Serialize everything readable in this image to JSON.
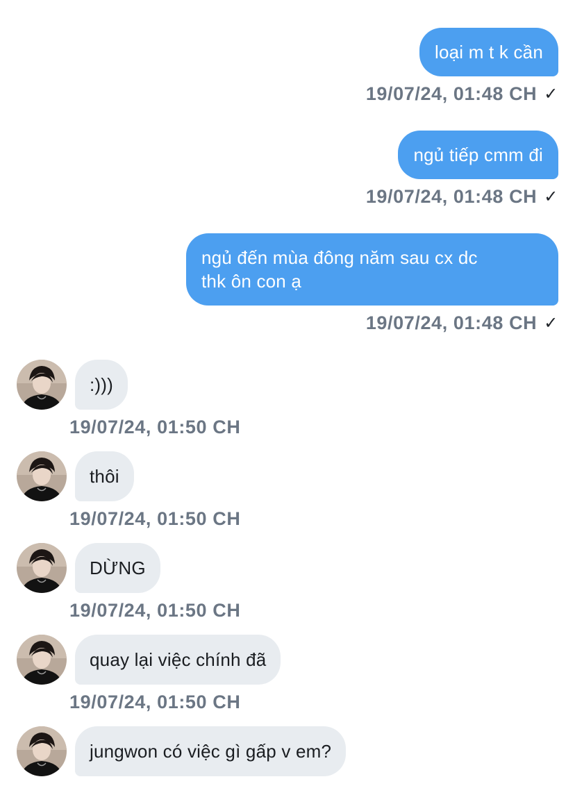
{
  "colors": {
    "outgoing_bubble": "#4c9ff0",
    "incoming_bubble": "#e8ecf0",
    "timestamp": "#6b7684"
  },
  "messages": [
    {
      "direction": "outgoing",
      "text": "loại m t k cần",
      "timestamp": "19/07/24, 01:48 CH",
      "status_icon": "check-icon",
      "status_glyph": "✓"
    },
    {
      "direction": "outgoing",
      "text": "ngủ tiếp cmm đi",
      "timestamp": "19/07/24, 01:48 CH",
      "status_icon": "check-icon",
      "status_glyph": "✓"
    },
    {
      "direction": "outgoing",
      "text_lines": [
        "ngủ đến mùa đông năm sau cx dc",
        "thk ôn con ạ"
      ],
      "timestamp": "19/07/24, 01:48 CH",
      "status_icon": "check-icon",
      "status_glyph": "✓"
    },
    {
      "direction": "incoming",
      "avatar": "avatar-icon",
      "text": ":)))",
      "timestamp": "19/07/24, 01:50 CH"
    },
    {
      "direction": "incoming",
      "avatar": "avatar-icon",
      "text": "thôi",
      "timestamp": "19/07/24, 01:50 CH"
    },
    {
      "direction": "incoming",
      "avatar": "avatar-icon",
      "text": "DỪNG",
      "timestamp": "19/07/24, 01:50 CH"
    },
    {
      "direction": "incoming",
      "avatar": "avatar-icon",
      "text": "quay lại việc chính đã",
      "timestamp": "19/07/24, 01:50 CH"
    },
    {
      "direction": "incoming",
      "avatar": "avatar-icon",
      "text": "jungwon có việc gì gấp v em?"
    }
  ]
}
